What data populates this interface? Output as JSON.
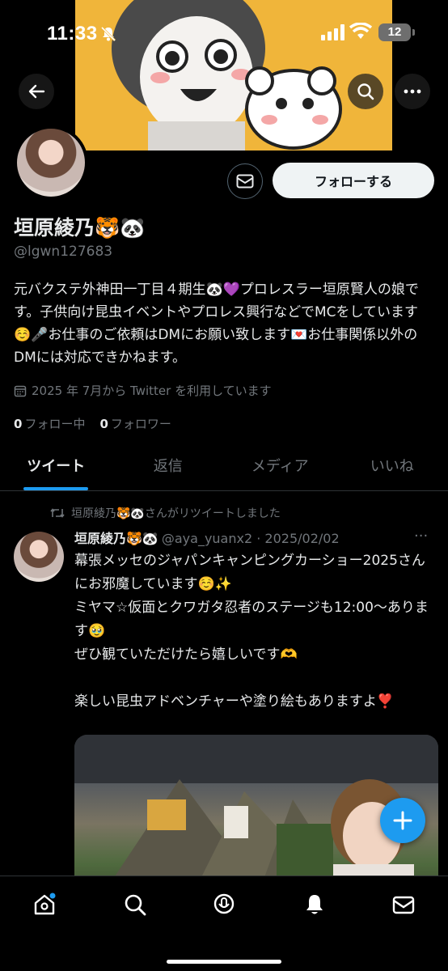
{
  "status_bar": {
    "time": "11:33",
    "battery": "12"
  },
  "profile": {
    "display_name": "垣原綾乃🐯🐼",
    "handle": "@lgwn127683",
    "bio": "元バクステ外神田一丁目４期生🐼💜プロレスラー垣原賢人の娘です。子供向け昆虫イベントやプロレス興行などでMCをしています☺️🎤お仕事のご依頼はDMにお願い致します💌お仕事関係以外のDMには対応できかねます。",
    "joined": "2025 年 7月から Twitter を利用しています",
    "following_count": "0",
    "following_label": "フォロー中",
    "followers_count": "0",
    "followers_label": "フォロワー",
    "follow_button": "フォローする"
  },
  "tabs": [
    {
      "label": "ツイート",
      "active": true
    },
    {
      "label": "返信"
    },
    {
      "label": "メディア"
    },
    {
      "label": "いいね"
    }
  ],
  "tweet": {
    "retweeted_by": "垣原綾乃🐯🐼さんがリツイートしました",
    "author_name": "垣原綾乃🐯🐼",
    "author_handle_date": "@aya_yuanx2 · 2025/02/02",
    "more": "···",
    "text": "幕張メッセのジャパンキャンピングカーショー2025さんにお邪魔しています☺️✨\nミヤマ☆仮面とクワガタ忍者のステージも12:00〜あります🥹\nぜひ観ていただけたら嬉しいです🫶\n\n楽しい昆虫アドベンチャーや塗り絵もありますよ❣️"
  },
  "colors": {
    "accent": "#1d9bf0",
    "banner": "#f0b53a",
    "background": "#000000",
    "muted": "#71767b"
  },
  "icons": {
    "nav": [
      "home-icon",
      "search-icon",
      "spaces-icon",
      "notifications-icon",
      "messages-icon"
    ]
  }
}
